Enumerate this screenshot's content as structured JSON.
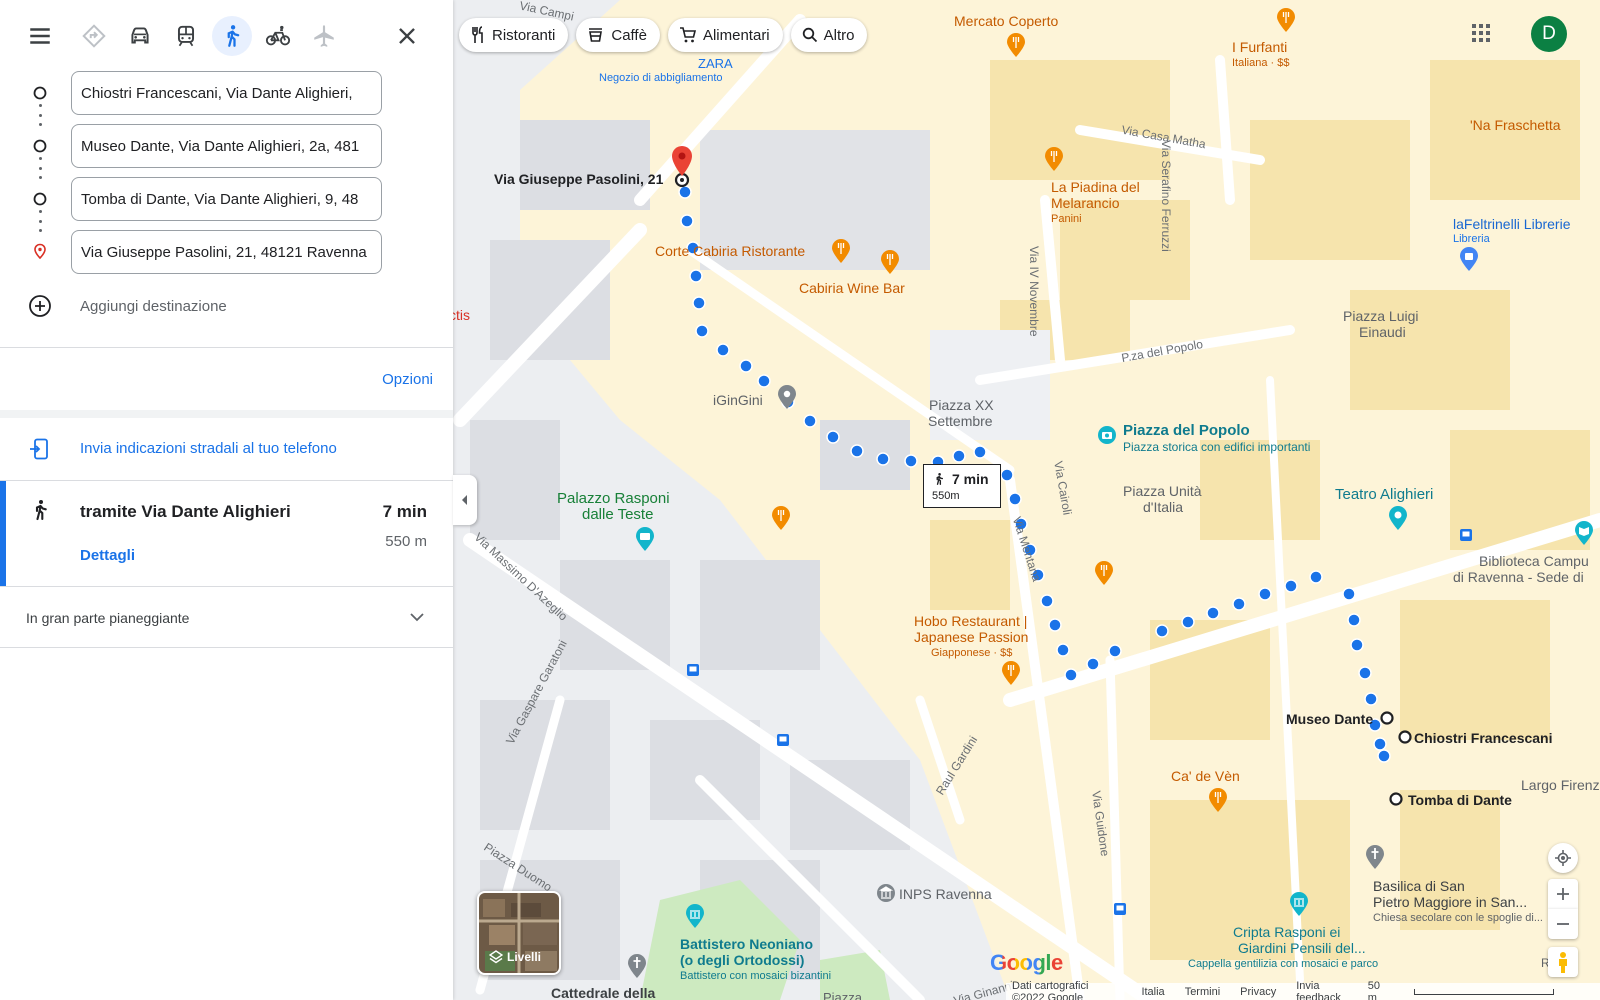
{
  "panel": {
    "modes": [
      {
        "name": "best-route",
        "icon": "diamond-route-icon"
      },
      {
        "name": "driving",
        "icon": "car-icon"
      },
      {
        "name": "transit",
        "icon": "train-icon"
      },
      {
        "name": "walking",
        "icon": "walk-icon",
        "active": true
      },
      {
        "name": "cycling",
        "icon": "bike-icon"
      },
      {
        "name": "flights",
        "icon": "plane-icon"
      }
    ],
    "stops": [
      {
        "value": "Chiostri Francescani, Via Dante Alighieri,"
      },
      {
        "value": "Museo Dante, Via Dante Alighieri, 2a, 481"
      },
      {
        "value": "Tomba di Dante, Via Dante Alighieri, 9, 48"
      },
      {
        "value": "Via Giuseppe Pasolini, 21, 48121 Ravenna"
      }
    ],
    "add_destination": "Aggiungi destinazione",
    "options_label": "Opzioni",
    "send_to_phone": "Invia indicazioni stradali al tuo telefono",
    "route": {
      "via": "tramite Via Dante Alighieri",
      "time": "7 min",
      "distance": "550 m",
      "details": "Dettagli"
    },
    "terrain": "In gran parte pianeggiante"
  },
  "map": {
    "chips": [
      "Ristoranti",
      "Caffè",
      "Alimentari",
      "Altro"
    ],
    "avatar_letter": "D",
    "route_box": {
      "time": "7 min",
      "distance": "550m"
    },
    "layers_label": "Livelli",
    "google": "Google",
    "footer": {
      "data": "Dati cartografici ©2022 Google",
      "country": "Italia",
      "terms": "Termini",
      "privacy": "Privacy",
      "feedback": "Invia feedback",
      "scale": "50 m"
    },
    "labels": {
      "campi": "Via Campi",
      "mercato": "Mercato Coperto",
      "zara": "ZARA",
      "zara_sub": "Negozio di abbigliamento",
      "furfanti": "I Furfanti",
      "furfanti_sub": "Italiana · $$",
      "frasc": "'Na Fraschetta",
      "serafino": "Via Serafino Ferruzzi",
      "casa_matha": "Via Casa Matha",
      "pasolini": "Via Giuseppe Pasolini, 21",
      "piadina1": "La Piadina del",
      "piadina2": "Melarancio",
      "piadina_sub": "Panini",
      "feltrinelli": "laFeltrinelli Librerie",
      "libreria": "Libreria",
      "corte": "Corte Cabiria Ristorante",
      "cabiria": "Cabiria Wine Bar",
      "iv_nov": "Via IV Novembre",
      "luigi1": "Piazza Luigi",
      "luigi2": "Einaudi",
      "ctis": "ctis",
      "pza_popolo": "P.za del Popolo",
      "gingini": "iGinGini",
      "xx1": "Piazza XX",
      "xx2": "Settembre",
      "popolo": "Piazza del Popolo",
      "popolo_sub": "Piazza storica con edifici importanti",
      "raspon1": "Palazzo Rasponi",
      "raspon2": "dalle Teste",
      "cairoli": "Via Cairoli",
      "unita1": "Piazza Unità",
      "unita2": "d'Italia",
      "teatro": "Teatro Alighieri",
      "dazeglio": "Via Massimo D'Azeglio",
      "mentana": "Via Mentana",
      "biblio1": "Biblioteca Campu",
      "biblio2": "di Ravenna - Sede di",
      "hobo1": "Hobo Restaurant |",
      "hobo2": "Japanese Passion",
      "hobo_sub": "Giapponese · $$",
      "museo": "Museo Dante",
      "chiostri": "Chiostri Francescani",
      "garatoni": "Via Gaspare Garatoni",
      "gardini": "Raul Gardini",
      "cadeven": "Ca' de Vèn",
      "tomba": "Tomba di Dante",
      "largo": "Largo Firenz",
      "duomo": "Piazza Duomo",
      "guidone": "Via Guidone",
      "inps": "INPS Ravenna",
      "basilica1": "Basilica di San",
      "basilica2": "Pietro Maggiore in San...",
      "basilica_sub": "Chiesa secolare con le spoglie di...",
      "battistero1": "Battistero Neoniano",
      "battistero2": "(o degli Ortodossi)",
      "battistero_sub": "Battistero con mosaici bizantini",
      "cripta1": "Cripta Rasponi ei",
      "cripta2": "Giardini Pensili del...",
      "cripta_sub": "Cappella gentilizia con mosaici e parco",
      "cattedrale": "Cattedrale della",
      "piazza_b": "Piazza",
      "ginanni": "Via Ginanni",
      "risto": "Risto"
    }
  }
}
